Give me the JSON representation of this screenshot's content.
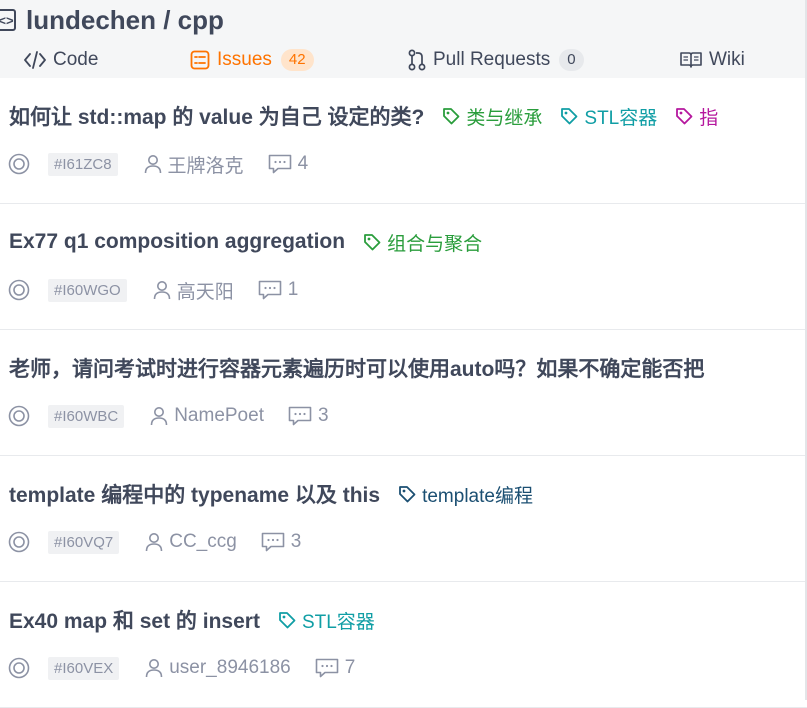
{
  "header": {
    "repo_title": "lundechen / cpp",
    "tabs": [
      {
        "label": "Code"
      },
      {
        "label": "Issues",
        "count": "42"
      },
      {
        "label": "Pull Requests",
        "count": "0"
      },
      {
        "label": "Wiki"
      }
    ]
  },
  "colors": {
    "accent": "#fe7300",
    "label_green": "#2a9d3c",
    "label_teal": "#109ea5",
    "label_magenta": "#b5179e",
    "label_navy": "#1b4f72"
  },
  "issues": [
    {
      "title": "如何让 std::map 的 value 为自己 设定的类?",
      "labels": [
        {
          "text": "类与继承",
          "color": "#2a9d3c"
        },
        {
          "text": "STL容器",
          "color": "#109ea5"
        },
        {
          "text": "指",
          "color": "#b5179e"
        }
      ],
      "id": "#I61ZC8",
      "author": "王牌洛克",
      "comments": "4"
    },
    {
      "title": "Ex77 q1 composition aggregation",
      "labels": [
        {
          "text": "组合与聚合",
          "color": "#2a9d3c"
        }
      ],
      "id": "#I60WGO",
      "author": "高天阳",
      "comments": "1"
    },
    {
      "title": "老师，请问考试时进行容器元素遍历时可以使用auto吗？如果不确定能否把",
      "labels": [],
      "id": "#I60WBC",
      "author": "NamePoet",
      "comments": "3"
    },
    {
      "title": "template 编程中的 typename 以及 this",
      "labels": [
        {
          "text": "template编程",
          "color": "#1b4f72"
        }
      ],
      "id": "#I60VQ7",
      "author": "CC_ccg",
      "comments": "3"
    },
    {
      "title": "Ex40 map 和 set 的 insert",
      "labels": [
        {
          "text": "STL容器",
          "color": "#109ea5"
        }
      ],
      "id": "#I60VEX",
      "author": "user_8946186",
      "comments": "7"
    }
  ]
}
